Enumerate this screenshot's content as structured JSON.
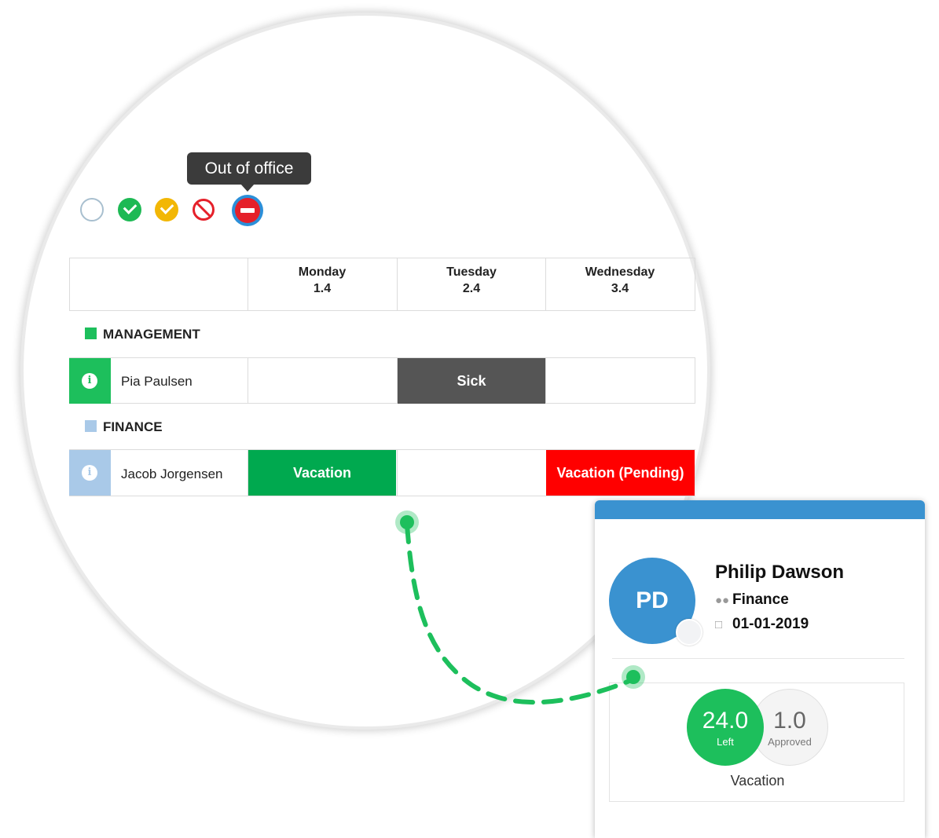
{
  "tooltip": "Out of office",
  "status_icons": [
    "empty-status",
    "approved-status",
    "pending-approved-status",
    "rejected-status",
    "out-of-office-status"
  ],
  "table": {
    "days": [
      {
        "name": "Monday",
        "date": "1.4"
      },
      {
        "name": "Tuesday",
        "date": "2.4"
      },
      {
        "name": "Wednesday",
        "date": "3.4"
      }
    ],
    "groups": [
      {
        "label": "MANAGEMENT",
        "color": "#1dbf5c"
      },
      {
        "label": "FINANCE",
        "color": "#a9c9e8"
      }
    ],
    "rows": [
      {
        "name": "Pia Paulsen",
        "info_color": "#1dbf5c",
        "cells": [
          "",
          "Sick",
          ""
        ]
      },
      {
        "name": "Jacob Jorgensen",
        "info_color": "#a9c9e8",
        "cells": [
          "Vacation",
          "",
          "Vacation (Pending)"
        ]
      }
    ],
    "colors": {
      "sick": "#555555",
      "vacation": "#00a94f",
      "pending": "#ff0000"
    }
  },
  "profile": {
    "initials": "PD",
    "name": "Philip Dawson",
    "department": "Finance",
    "date": "01-01-2019",
    "left_value": "24.0",
    "left_label": "Left",
    "approved_value": "1.0",
    "approved_label": "Approved",
    "absence_type": "Vacation"
  }
}
